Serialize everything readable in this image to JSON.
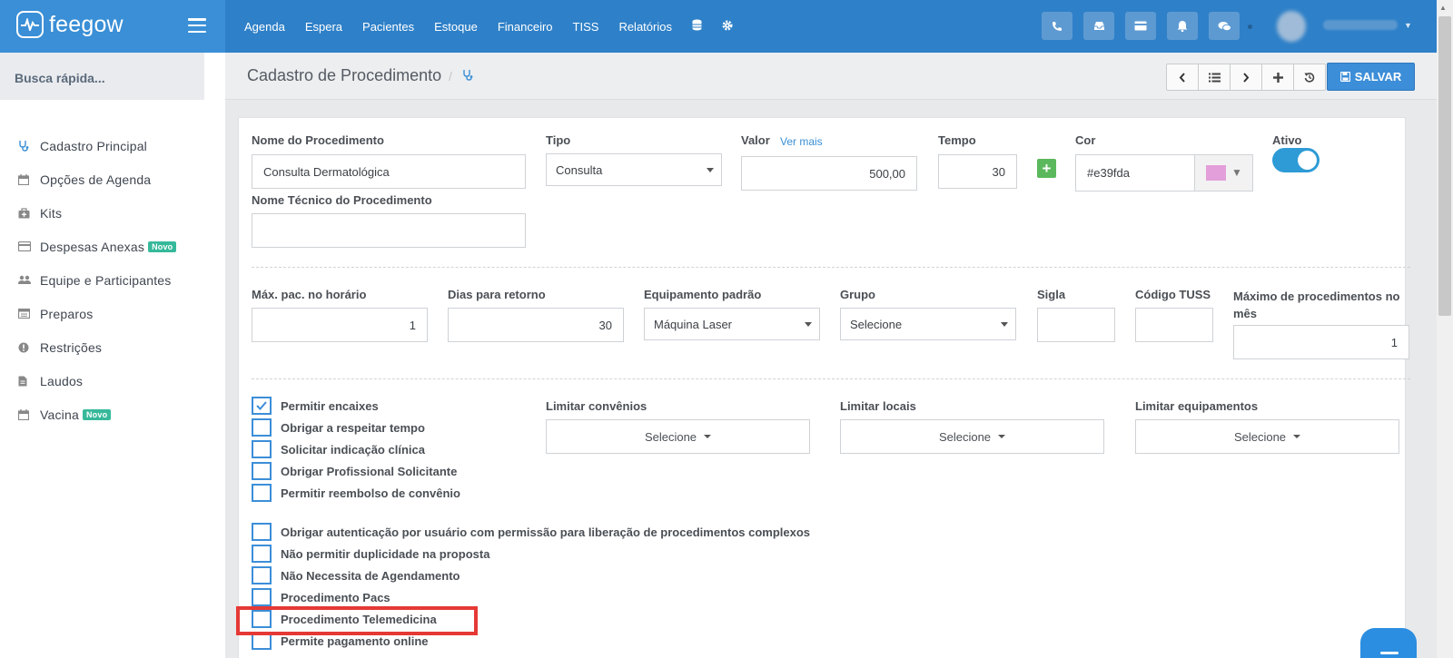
{
  "brand": {
    "name": "feegow"
  },
  "nav": {
    "items": [
      "Agenda",
      "Espera",
      "Pacientes",
      "Estoque",
      "Financeiro",
      "TISS",
      "Relatórios"
    ]
  },
  "topbar_icons": [
    "phone-icon",
    "inbox-icon",
    "card-icon",
    "bell-icon",
    "chat-icon"
  ],
  "sidebar": {
    "quick_search": "Busca rápida...",
    "items": [
      {
        "label": "Cadastro Principal",
        "icon": "stethoscope-icon"
      },
      {
        "label": "Opções de Agenda",
        "icon": "calendar-icon"
      },
      {
        "label": "Kits",
        "icon": "medkit-icon"
      },
      {
        "label": "Despesas Anexas",
        "icon": "card-icon",
        "badge": "Novo"
      },
      {
        "label": "Equipe e Participantes",
        "icon": "users-icon"
      },
      {
        "label": "Preparos",
        "icon": "list-icon"
      },
      {
        "label": "Restrições",
        "icon": "alert-icon"
      },
      {
        "label": "Laudos",
        "icon": "file-icon"
      },
      {
        "label": "Vacina",
        "icon": "calendar-icon",
        "badge": "Novo"
      }
    ]
  },
  "page": {
    "title": "Cadastro de Procedimento",
    "save_label": "SALVAR"
  },
  "form": {
    "nome_label": "Nome do Procedimento",
    "nome_value": "Consulta Dermatológica",
    "tipo_label": "Tipo",
    "tipo_value": "Consulta",
    "valor_label": "Valor",
    "valor_link": "Ver mais",
    "valor_value": "500,00",
    "tempo_label": "Tempo",
    "tempo_value": "30",
    "cor_label": "Cor",
    "cor_value": "#e39fda",
    "ativo_label": "Ativo",
    "ativo_on": true,
    "nome_tecnico_label": "Nome Técnico do Procedimento",
    "nome_tecnico_value": "",
    "max_pac_label": "Máx. pac. no horário",
    "max_pac_value": "1",
    "dias_retorno_label": "Dias para retorno",
    "dias_retorno_value": "30",
    "equip_label": "Equipamento padrão",
    "equip_value": "Máquina Laser",
    "grupo_label": "Grupo",
    "grupo_value": "Selecione",
    "sigla_label": "Sigla",
    "sigla_value": "",
    "tuss_label": "Código TUSS",
    "tuss_value": "",
    "max_mes_label": "Máximo de procedimentos no mês",
    "max_mes_value": "1",
    "limitar_convenios_label": "Limitar convênios",
    "limitar_locais_label": "Limitar locais",
    "limitar_equip_label": "Limitar equipamentos",
    "selecione": "Selecione"
  },
  "checkboxes_group1": [
    {
      "label": "Permitir encaixes",
      "checked": true
    },
    {
      "label": "Obrigar a respeitar tempo",
      "checked": false
    },
    {
      "label": "Solicitar indicação clínica",
      "checked": false
    },
    {
      "label": "Obrigar Profissional Solicitante",
      "checked": false
    },
    {
      "label": "Permitir reembolso de convênio",
      "checked": false
    }
  ],
  "checkboxes_group2": [
    {
      "label": "Obrigar autenticação por usuário com permissão para liberação de procedimentos complexos",
      "checked": false
    },
    {
      "label": "Não permitir duplicidade na proposta",
      "checked": false
    },
    {
      "label": "Não Necessita de Agendamento",
      "checked": false
    },
    {
      "label": "Procedimento Pacs",
      "checked": false
    },
    {
      "label": "Procedimento Telemedicina",
      "checked": false
    },
    {
      "label": "Permite pagamento online",
      "checked": false
    }
  ],
  "colors": {
    "topbar": "#2e80c8",
    "accent": "#3c8ed8",
    "highlight": "#e53935",
    "swatch": "#e39fda"
  }
}
